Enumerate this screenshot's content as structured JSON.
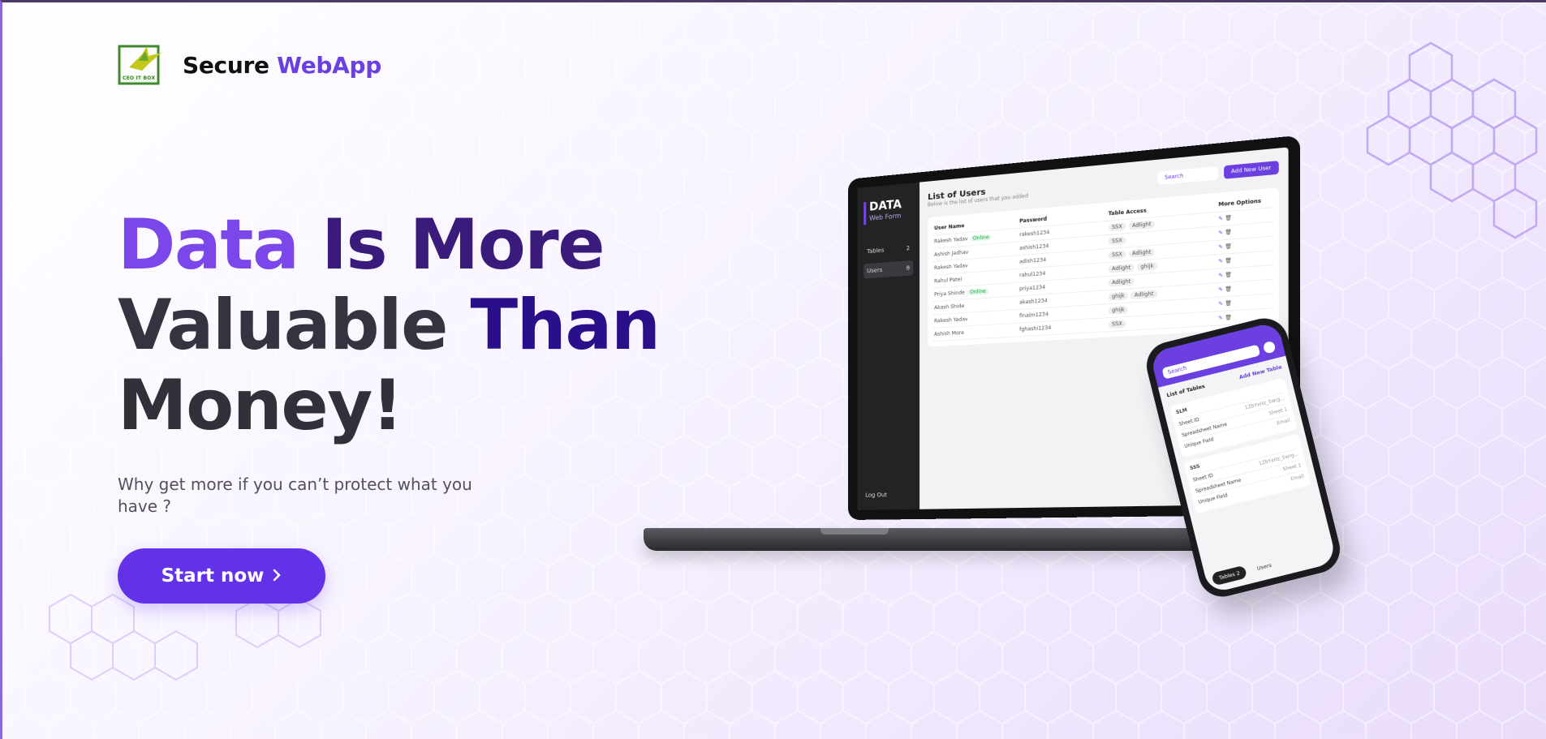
{
  "brand": {
    "logo_text": "CEO IT BOX",
    "name_part1": "Secure",
    "name_part2": "WebApp"
  },
  "hero": {
    "line1_a": "Data",
    "line1_b": " Is More",
    "line2_a": "Valuable",
    "line2_b": " Than",
    "line3": "Money!",
    "subtitle": "Why get more if you can’t protect what you have ?",
    "cta_label": "Start now",
    "cta_icon": "chevron-right-icon"
  },
  "laptop_app": {
    "brand": "DATA",
    "brand_sub": "Web Form",
    "nav": [
      {
        "label": "Tables",
        "count": "2"
      },
      {
        "label": "Users",
        "count": "8"
      }
    ],
    "logout": "Log Out",
    "title": "List of Users",
    "subtitle": "Below is the list of users that you added",
    "search_placeholder": "Search",
    "add_button": "Add New User",
    "columns": [
      "User Name",
      "Password",
      "Table Access",
      "More Options"
    ],
    "rows": [
      {
        "name": "Rakesh Yadav",
        "online": "Online",
        "password": "rakesh1234",
        "access": [
          "SSX",
          "Adlight"
        ]
      },
      {
        "name": "Ashish Jadhav",
        "online": "",
        "password": "ashish1234",
        "access": [
          "SSX"
        ]
      },
      {
        "name": "Rakesh Yadav",
        "online": "",
        "password": "adish1234",
        "access": [
          "SSX",
          "Adlight"
        ]
      },
      {
        "name": "Rahul Patel",
        "online": "",
        "password": "rahul1234",
        "access": [
          "Adlight",
          "ghijk"
        ]
      },
      {
        "name": "Priya Shinde",
        "online": "Online",
        "password": "priya1234",
        "access": [
          "Adlight"
        ]
      },
      {
        "name": "Akash Shide",
        "online": "",
        "password": "akash1234",
        "access": [
          "ghijk",
          "Adlight"
        ]
      },
      {
        "name": "Rakesh Yadav",
        "online": "",
        "password": "finalm1234",
        "access": [
          "ghijk"
        ]
      },
      {
        "name": "Ashish More",
        "online": "",
        "password": "fghashi1234",
        "access": [
          "SSX"
        ]
      }
    ]
  },
  "phone_app": {
    "search_placeholder": "Search",
    "title": "List of Tables",
    "add_button": "Add New Table",
    "tables": [
      {
        "name": "SLM",
        "fields": [
          [
            "Sheet ID",
            "1ZbYxHz_5wrg..."
          ],
          [
            "Spreadsheet Name",
            "Sheet 1"
          ],
          [
            "Unique Field",
            "Email"
          ]
        ]
      },
      {
        "name": "SSS",
        "fields": [
          [
            "Sheet ID",
            "1ZbYxHz_5wrg..."
          ],
          [
            "Spreadsheet Name",
            "Sheet 1"
          ],
          [
            "Unique Field",
            "Email"
          ]
        ]
      }
    ],
    "tabs": [
      {
        "label": "Tables",
        "count": "2"
      },
      {
        "label": "Users",
        "count": ""
      }
    ]
  },
  "colors": {
    "accent": "#6b3fe0",
    "dark_purple": "#2b0f8a",
    "text_dark": "#343039"
  }
}
